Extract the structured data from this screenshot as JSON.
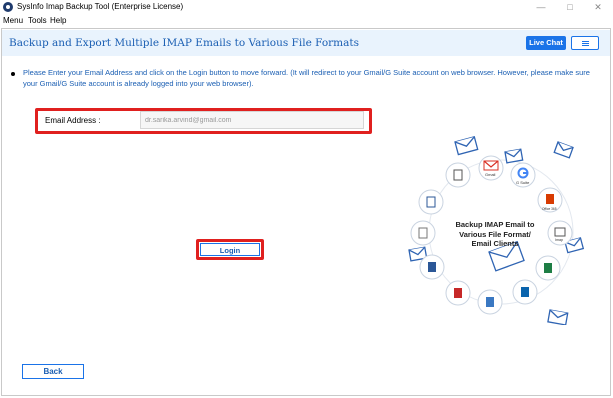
{
  "window": {
    "title": "SysInfo Imap Backup Tool (Enterprise License)"
  },
  "menu": {
    "items": [
      "Menu",
      "Tools",
      "Help"
    ]
  },
  "header": {
    "title": "Backup and Export Multiple IMAP Emails to Various File Formats",
    "live_chat": "Live Chat"
  },
  "instructions": "Please Enter your Email Address and click on the Login button to move forward. (It will redirect to your Gmail/G Suite account on web browser. However, please make sure your Gmail/G Suite account is already logged into your web browser).",
  "email": {
    "label": "Email Address :",
    "value": "dr.sarika.arvind@gmail.com"
  },
  "login_label": "Login",
  "back_label": "Back",
  "graphic": {
    "caption_line1": "Backup IMAP Email to",
    "caption_line2": "Various File Format/",
    "caption_line3": "Email Clients",
    "icon_labels": {
      "gmail": "Gmail",
      "gsuite": "G Suite",
      "office365": "Office 365",
      "imap": "Imap"
    }
  },
  "colors": {
    "accent": "#1a73e8",
    "highlight": "#e0201f",
    "text_blue": "#1b5fb3",
    "header_bg": "#e9f3fd"
  }
}
